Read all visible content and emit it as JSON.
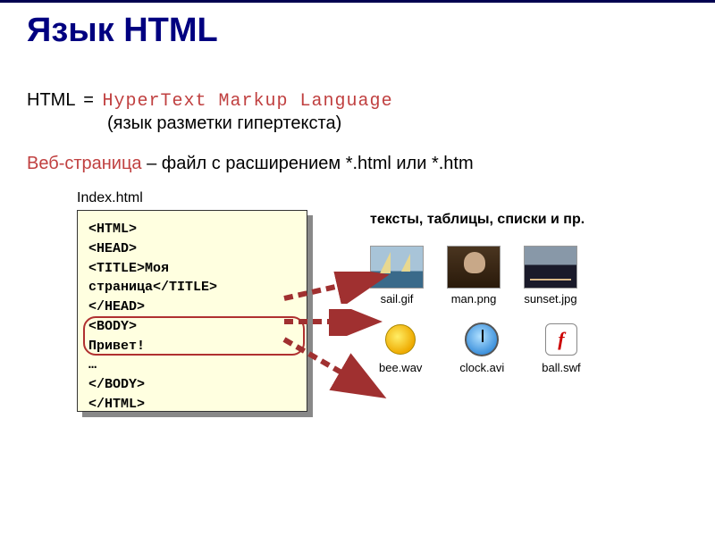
{
  "title": "Язык HTML",
  "definition": {
    "abbr": "HTML",
    "eq": "=",
    "expansion": "HyperText Markup Language",
    "translation": "(язык разметки гипертекста)"
  },
  "webpage": {
    "term": "Веб-страница",
    "desc": " – файл с расширением *.html или *.htm"
  },
  "code": {
    "filename": "Index.html",
    "lines": {
      "l1": "<HTML>",
      "l2": "<HEAD>",
      "l3": "<TITLE>Моя страница</TITLE>",
      "l4": "</HEAD>",
      "l5": "<BODY>",
      "l6": "Привет!",
      "l7": "…",
      "l8": "</BODY>",
      "l9": "</HTML>"
    }
  },
  "caption": "тексты, таблицы, списки и пр.",
  "files": {
    "sail": "sail.gif",
    "man": "man.png",
    "sunset": "sunset.jpg",
    "bee": "bee.wav",
    "clock": "clock.avi",
    "ball": "ball.swf"
  }
}
